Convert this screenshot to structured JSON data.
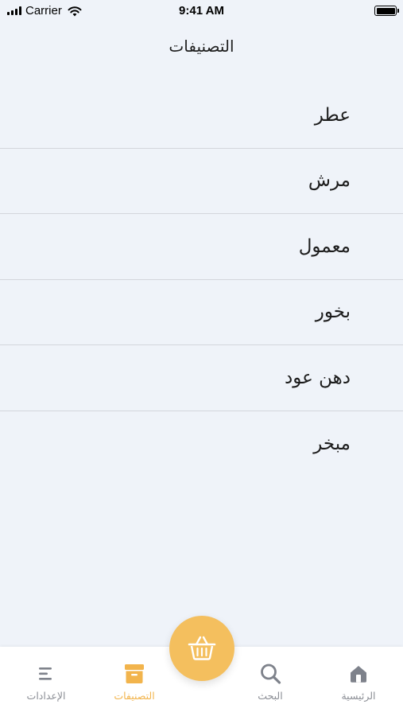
{
  "status_bar": {
    "carrier": "Carrier",
    "time": "9:41 AM"
  },
  "header": {
    "title": "التصنيفات"
  },
  "categories": [
    {
      "label": "عطر"
    },
    {
      "label": "مرش"
    },
    {
      "label": "معمول"
    },
    {
      "label": "بخور"
    },
    {
      "label": "دهن عود"
    },
    {
      "label": "مبخر"
    }
  ],
  "tab_bar": {
    "settings_label": "الإعدادات",
    "categories_label": "التصنيفات",
    "search_label": "البحث",
    "home_label": "الرئيسية",
    "active_tab": "categories"
  },
  "cart_button": {
    "icon": "basket-icon"
  },
  "colors": {
    "accent": "#f4bf5e",
    "active_label": "#f2b44c",
    "inactive": "#8b8e95",
    "background": "#eff3f9"
  }
}
